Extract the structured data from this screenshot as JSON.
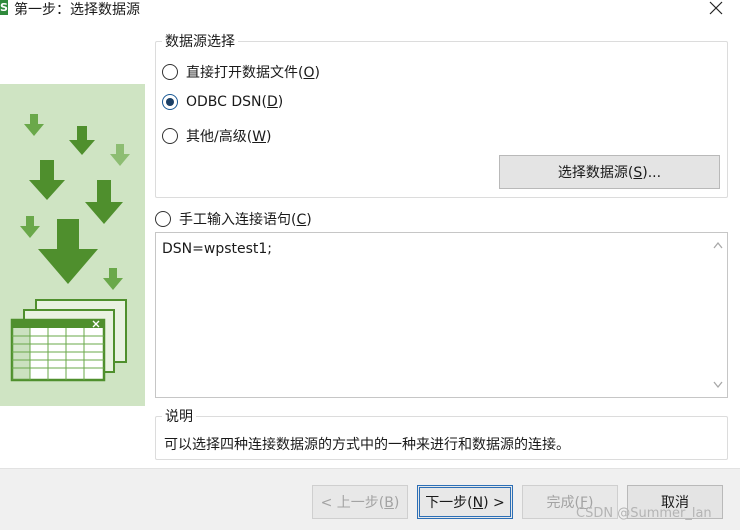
{
  "window": {
    "title": "第一步：选择数据源",
    "app_icon_text": "S"
  },
  "datasource_group": {
    "legend": "数据源选择",
    "options": [
      {
        "label": "直接打开数据文件(",
        "mnemonic": "O",
        "suffix": ")",
        "checked": false
      },
      {
        "label": "ODBC DSN(",
        "mnemonic": "D",
        "suffix": ")",
        "checked": true
      },
      {
        "label": "其他/高级(",
        "mnemonic": "W",
        "suffix": ")",
        "checked": false
      }
    ],
    "select_button": {
      "label": "选择数据源(",
      "mnemonic": "S",
      "suffix": ")..."
    }
  },
  "manual": {
    "label": "手工输入连接语句(",
    "mnemonic": "C",
    "suffix": ")",
    "checked": false,
    "connection_string": "DSN=wpstest1;"
  },
  "description": {
    "legend": "说明",
    "text": "可以选择四种连接数据源的方式中的一种来进行和数据源的连接。"
  },
  "buttons": {
    "back": {
      "label": "< 上一步(",
      "mnemonic": "B",
      "suffix": ")",
      "enabled": false
    },
    "next": {
      "label": "下一步(",
      "mnemonic": "N",
      "suffix": ") >",
      "enabled": true
    },
    "finish": {
      "label": "完成(",
      "mnemonic": "F",
      "suffix": ")",
      "enabled": false
    },
    "cancel": {
      "label": "取消",
      "enabled": true
    }
  },
  "watermark": "CSDN @Summer_lan",
  "colors": {
    "illustration_bg": "#cfe4c3",
    "arrow_dark": "#4f8f2d",
    "arrow_mid": "#6aa84a",
    "arrow_light": "#8dbd72",
    "radio_fill": "#1a3f66",
    "focus_blue": "#2d6fb6"
  },
  "icons": {
    "close": "close-icon",
    "illustration": "data-import-illustration",
    "scroll_up": "scroll-up-icon",
    "scroll_down": "scroll-down-icon"
  }
}
